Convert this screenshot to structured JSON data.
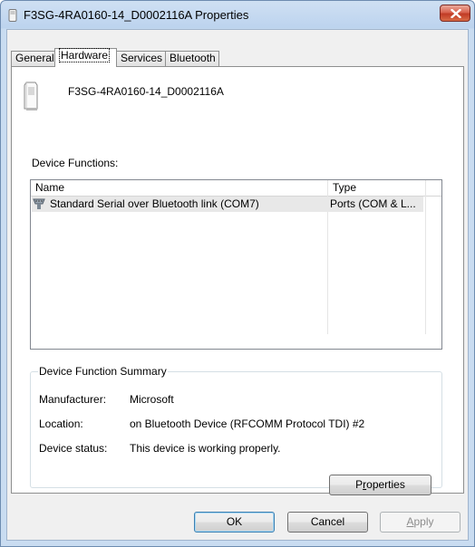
{
  "window": {
    "title": "F3SG-4RA0160-14_D0002116A Properties"
  },
  "tabs": [
    {
      "label": "General"
    },
    {
      "label": "Hardware"
    },
    {
      "label": "Services"
    },
    {
      "label": "Bluetooth"
    }
  ],
  "device": {
    "name": "F3SG-4RA0160-14_D0002116A"
  },
  "functions": {
    "label": "Device Functions:",
    "columns": [
      "Name",
      "Type"
    ],
    "rows": [
      {
        "name": "Standard Serial over Bluetooth link (COM7)",
        "type": "Ports (COM & L..."
      }
    ]
  },
  "summary": {
    "title": "Device Function Summary",
    "manufacturer_label": "Manufacturer:",
    "manufacturer": "Microsoft",
    "location_label": "Location:",
    "location": "on Bluetooth Device (RFCOMM Protocol TDI) #2",
    "status_label": "Device status:",
    "status": "This device is working properly.",
    "properties_pre": "P",
    "properties_mnemonic": "r",
    "properties_post": "operties"
  },
  "buttons": {
    "ok": "OK",
    "cancel": "Cancel",
    "apply_mnemonic": "A",
    "apply_post": "pply"
  },
  "colors": {
    "accent": "#3c7fb1",
    "title_bar": "#c9dcf1",
    "close": "#c13b25"
  }
}
